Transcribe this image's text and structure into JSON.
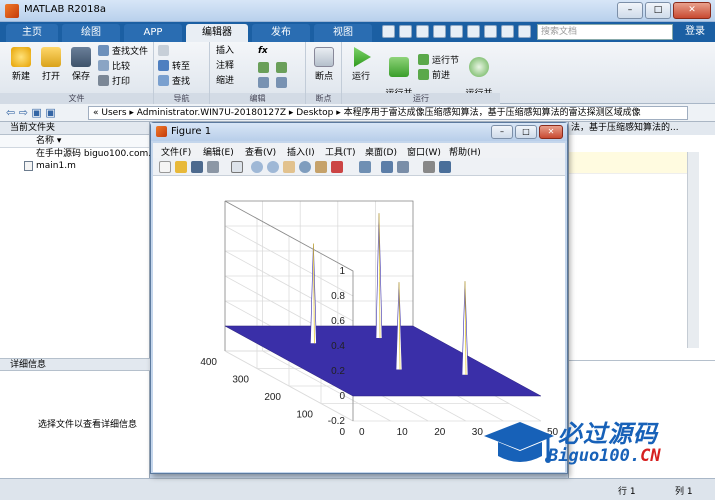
{
  "window": {
    "title": "MATLAB R2018a",
    "min": "–",
    "max": "□",
    "close": "✕"
  },
  "tabs": [
    {
      "label": "主页"
    },
    {
      "label": "绘图"
    },
    {
      "label": "APP"
    },
    {
      "label": "编辑器"
    },
    {
      "label": "发布"
    },
    {
      "label": "视图"
    }
  ],
  "search": {
    "placeholder": "搜索文档"
  },
  "login": "登录",
  "ribbon": {
    "file_group": "文件",
    "new": "新建",
    "open": "打开",
    "save": "保存",
    "find_files": "查找文件",
    "compare": "比较",
    "print": "打印",
    "nav_group": "导航",
    "goto": "转至",
    "find": "查找",
    "edit_group": "编辑",
    "insert": "插入",
    "fx": "fx",
    "comment": "注释",
    "indent": "缩进",
    "bp_group": "断点",
    "breakpoints": "断点",
    "run_group": "运行",
    "run": "运行",
    "run_advance": "运行并\n前进",
    "run_section": "运行节",
    "advance": "前进",
    "run_time": "运行并\n计时"
  },
  "address": {
    "path": "«  Users  ▸  Administrator.WIN7U-20180127Z  ▸  Desktop  ▸  本程序用于雷达成像压缩感知算法，基于压缩感知算法的雷达探测区域成像"
  },
  "left_panel": {
    "title": "当前文件夹",
    "column": "名称 ▾",
    "files": [
      {
        "name": "在手中源码 biguo100.com.txt"
      },
      {
        "name": "main1.m"
      }
    ],
    "detail_title": "详细信息",
    "detail_msg": "选择文件以查看详细信息"
  },
  "editor": {
    "title": "法，基于压缩感知算法的..."
  },
  "status": {
    "row_label": "行",
    "row": "1",
    "col_label": "列",
    "col": "1"
  },
  "figure": {
    "title": "Figure 1",
    "menus": [
      "文件(F)",
      "编辑(E)",
      "查看(V)",
      "插入(I)",
      "工具(T)",
      "桌面(D)",
      "窗口(W)",
      "帮助(H)"
    ]
  },
  "chart_data": {
    "type": "surface-3d",
    "z_ticks": [
      "1",
      "0.8",
      "0.6",
      "0.4",
      "0.2",
      "0",
      "-0.2"
    ],
    "y_ticks": [
      "400",
      "300",
      "200",
      "100",
      "0"
    ],
    "x_ticks": [
      "0",
      "10",
      "20",
      "30",
      "40",
      "50"
    ],
    "zlim": [
      -0.2,
      1
    ],
    "ylim": [
      0,
      400
    ],
    "xlim": [
      0,
      50
    ],
    "surface_color": "#3a2fa8",
    "peaks": [
      {
        "x": 15,
        "y": 300,
        "z": 0.8
      },
      {
        "x": 25,
        "y": 150,
        "z": 0.7
      },
      {
        "x": 35,
        "y": 330,
        "z": 1.0
      },
      {
        "x": 40,
        "y": 120,
        "z": 0.75
      }
    ],
    "grid": true
  },
  "watermark": {
    "cn": "必过源码",
    "en": "Biguo100.",
    "en_red": "CN"
  }
}
